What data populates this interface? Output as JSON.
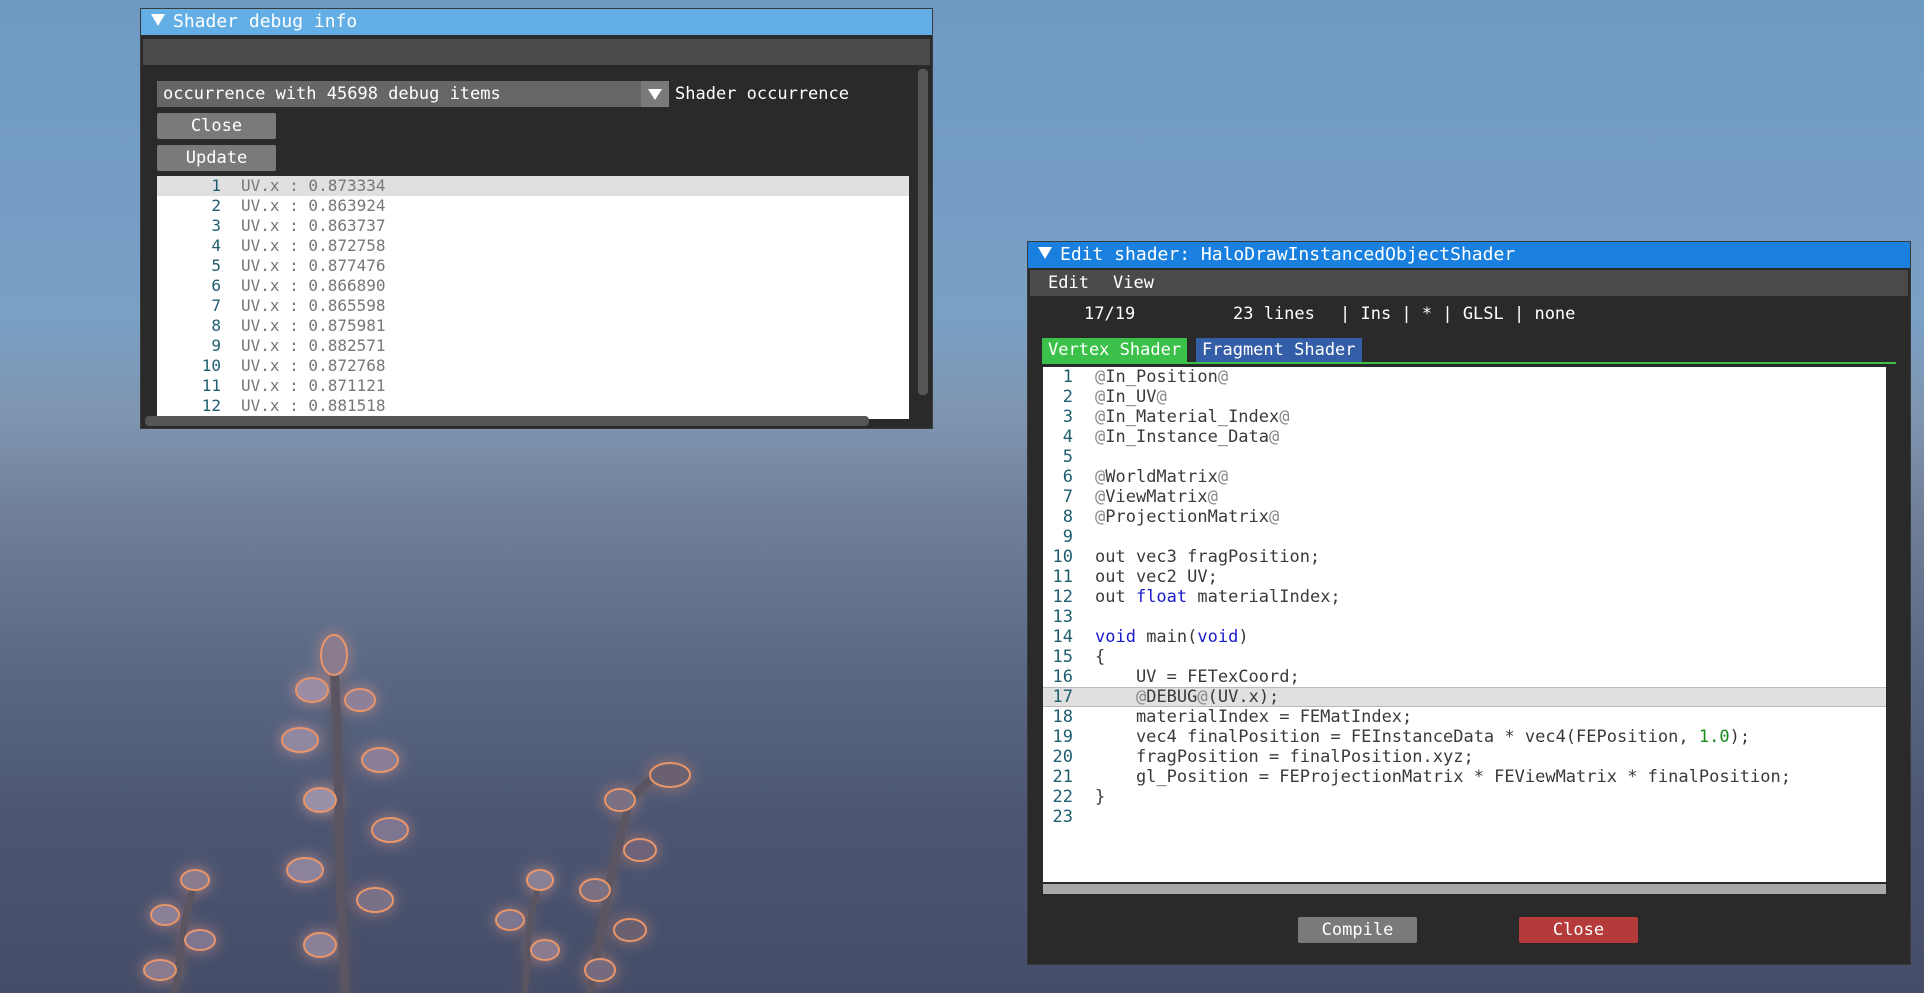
{
  "debug_window": {
    "title": "Shader debug info",
    "occurrence_select_value": "occurrence with 45698 debug items",
    "occurrence_label": "Shader occurrence",
    "close_label": "Close",
    "update_label": "Update",
    "items": [
      {
        "n": "1",
        "text": "UV.x : 0.873334"
      },
      {
        "n": "2",
        "text": "UV.x : 0.863924"
      },
      {
        "n": "3",
        "text": "UV.x : 0.863737"
      },
      {
        "n": "4",
        "text": "UV.x : 0.872758"
      },
      {
        "n": "5",
        "text": "UV.x : 0.877476"
      },
      {
        "n": "6",
        "text": "UV.x : 0.866890"
      },
      {
        "n": "7",
        "text": "UV.x : 0.865598"
      },
      {
        "n": "8",
        "text": "UV.x : 0.875981"
      },
      {
        "n": "9",
        "text": "UV.x : 0.882571"
      },
      {
        "n": "10",
        "text": "UV.x : 0.872768"
      },
      {
        "n": "11",
        "text": "UV.x : 0.871121"
      },
      {
        "n": "12",
        "text": "UV.x : 0.881518"
      }
    ]
  },
  "editor_window": {
    "title": "Edit shader: HaloDrawInstancedObjectShader",
    "menu": {
      "edit": "Edit",
      "view": "View"
    },
    "status": {
      "cursor": "17/19",
      "lines": "23 lines",
      "mode": "| Ins | * | GLSL | none"
    },
    "tabs": {
      "vertex": "Vertex Shader",
      "fragment": "Fragment Shader"
    },
    "compile_label": "Compile",
    "close_label": "Close",
    "code_lines": [
      "@In_Position@",
      "@In_UV@",
      "@In_Material_Index@",
      "@In_Instance_Data@",
      "",
      "@WorldMatrix@",
      "@ViewMatrix@",
      "@ProjectionMatrix@",
      "",
      "out vec3 fragPosition;",
      "out vec2 UV;",
      "out float materialIndex;",
      "",
      "void main(void)",
      "{",
      "    UV = FETexCoord;",
      "    @DEBUG@(UV.x);",
      "    materialIndex = FEMatIndex;",
      "    vec4 finalPosition = FEInstanceData * vec4(FEPosition, 1.0);",
      "    fragPosition = finalPosition.xyz;",
      "    gl_Position = FEProjectionMatrix * FEViewMatrix * finalPosition;",
      "}",
      ""
    ]
  },
  "colors": {
    "debug_title_bg": "#64aee6",
    "editor_title_bg": "#1a80e0",
    "vertex_tab_bg": "#3bc14a",
    "fragment_tab_bg": "#345ea8",
    "close_button_bg": "#b53a3a"
  }
}
